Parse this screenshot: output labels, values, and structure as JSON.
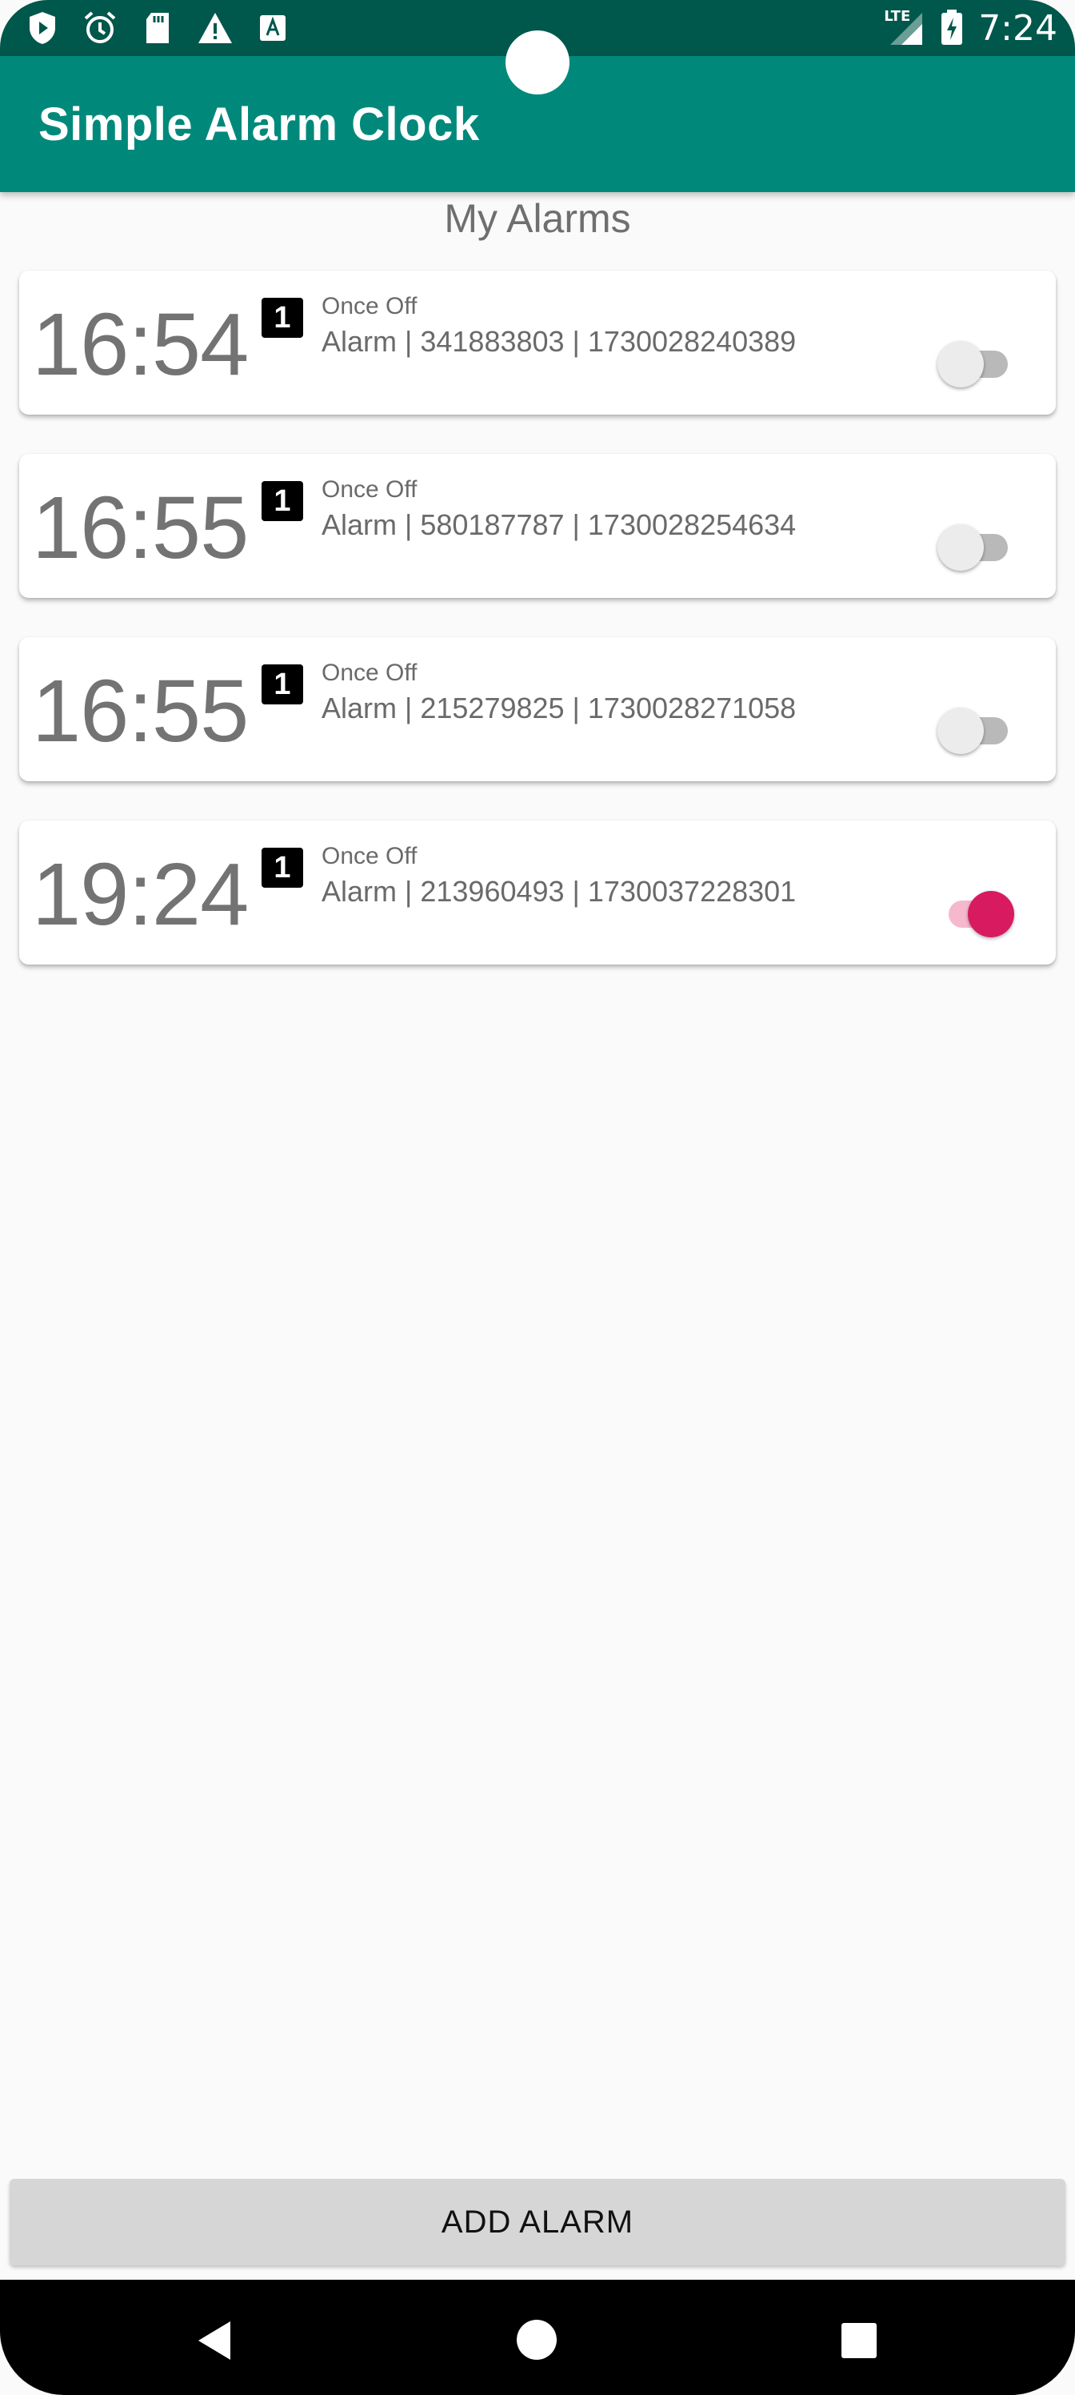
{
  "status_bar": {
    "time": "7:24",
    "network": "LTE",
    "icons": [
      "play-protect-icon",
      "alarm-icon",
      "sd-card-icon",
      "warning-icon",
      "text-a-icon"
    ]
  },
  "app_bar": {
    "title": "Simple Alarm Clock",
    "color": "#00897b"
  },
  "section_title": "My Alarms",
  "alarms": [
    {
      "time": "16:54",
      "badge": "1",
      "frequency": "Once Off",
      "label": "Alarm | 341883803 | 1730028240389",
      "enabled": false
    },
    {
      "time": "16:55",
      "badge": "1",
      "frequency": "Once Off",
      "label": "Alarm | 580187787 | 1730028254634",
      "enabled": false
    },
    {
      "time": "16:55",
      "badge": "1",
      "frequency": "Once Off",
      "label": "Alarm | 215279825 | 1730028271058",
      "enabled": false
    },
    {
      "time": "19:24",
      "badge": "1",
      "frequency": "Once Off",
      "label": "Alarm | 213960493 | 1730037228301",
      "enabled": true
    }
  ],
  "add_button_label": "ADD ALARM",
  "colors": {
    "accent": "#d81b60",
    "primary": "#00897b",
    "primary_dark": "#00574b"
  }
}
